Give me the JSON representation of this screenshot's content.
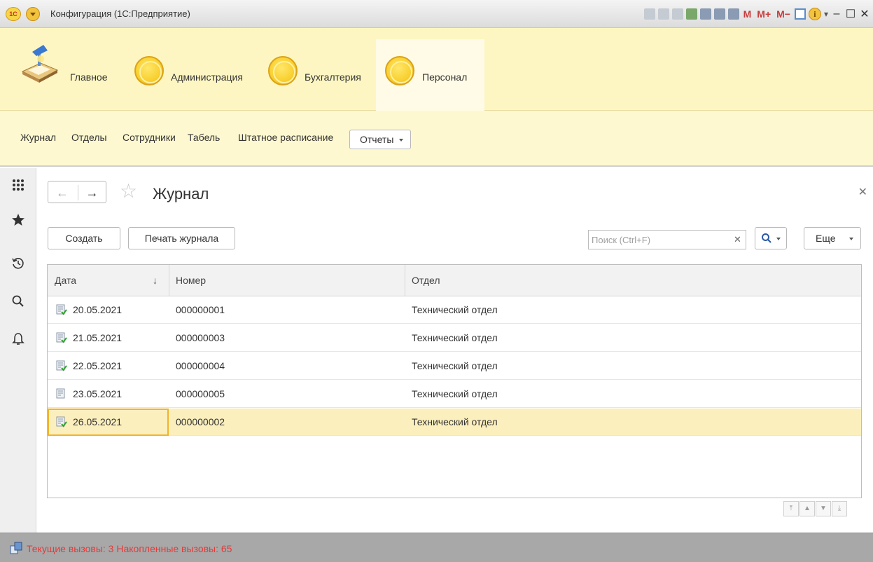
{
  "window": {
    "title": "Конфигурация (1С:Предприятие)",
    "logo_text": "1С"
  },
  "toolbar": {
    "m": "M",
    "m_plus": "M+",
    "m_minus": "M−",
    "info": "i"
  },
  "sections": [
    {
      "label": "Главное",
      "active": false
    },
    {
      "label": "Администрация",
      "active": false
    },
    {
      "label": "Бухгалтерия",
      "active": false
    },
    {
      "label": "Персонал",
      "active": true
    }
  ],
  "subsections": {
    "items": [
      "Журнал",
      "Отделы",
      "Сотрудники",
      "Табель",
      "Штатное расписание"
    ],
    "reports_label": "Отчеты"
  },
  "form": {
    "title": "Журнал",
    "create_label": "Создать",
    "print_label": "Печать журнала",
    "search_placeholder": "Поиск (Ctrl+F)",
    "more_label": "Еще"
  },
  "table": {
    "columns": [
      "Дата",
      "Номер",
      "Отдел"
    ],
    "sort_indicator": "↓",
    "rows": [
      {
        "date": "20.05.2021",
        "number": "000000001",
        "department": "Технический отдел",
        "selected": false
      },
      {
        "date": "21.05.2021",
        "number": "000000003",
        "department": "Технический отдел",
        "selected": false
      },
      {
        "date": "22.05.2021",
        "number": "000000004",
        "department": "Технический отдел",
        "selected": false
      },
      {
        "date": "23.05.2021",
        "number": "000000005",
        "department": "Технический отдел",
        "selected": false
      },
      {
        "date": "26.05.2021",
        "number": "000000002",
        "department": "Технический отдел",
        "selected": true
      }
    ]
  },
  "status": {
    "text": "Текущие вызовы: 3  Накопленные вызовы: 65"
  },
  "colors": {
    "sections_bg": "#fef6c2",
    "selected_row": "#fcefbe",
    "selected_border": "#f0b52b",
    "status_text": "#e23b3b"
  }
}
